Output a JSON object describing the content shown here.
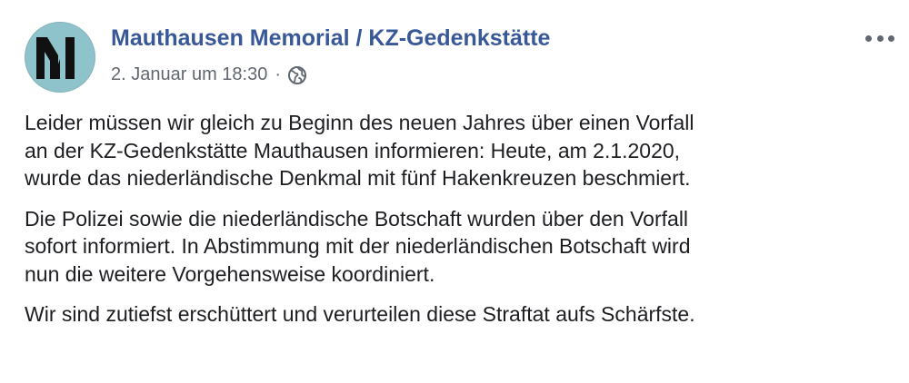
{
  "post": {
    "page_name": "Mauthausen Memorial / KZ-Gedenkstätte",
    "timestamp": "2. Januar um 18:30",
    "separator": "·",
    "privacy_icon": "globe-icon",
    "avatar_icon": "mauthausen-logo-icon",
    "menu_icon": "more-options-icon",
    "paragraphs": [
      {
        "lines": [
          "Leider müssen wir gleich zu Beginn des neuen Jahres über einen Vorfall",
          "an der KZ-Gedenkstätte Mauthausen informieren: Heute, am 2.1.2020,",
          "wurde das niederländische Denkmal mit fünf Hakenkreuzen beschmiert."
        ]
      },
      {
        "lines": [
          "Die Polizei sowie die niederländische Botschaft wurden über den Vorfall",
          "sofort informiert. In Abstimmung mit der niederländischen Botschaft wird",
          "nun die weitere Vorgehensweise koordiniert."
        ]
      },
      {
        "lines": [
          "Wir sind zutiefst erschüttert und verurteilen diese Straftat aufs Schärfste."
        ]
      }
    ]
  },
  "colors": {
    "page_name": "#385898",
    "meta_text": "#616770",
    "body_text": "#1c1e21",
    "avatar_bg": "#8fc3cb"
  }
}
